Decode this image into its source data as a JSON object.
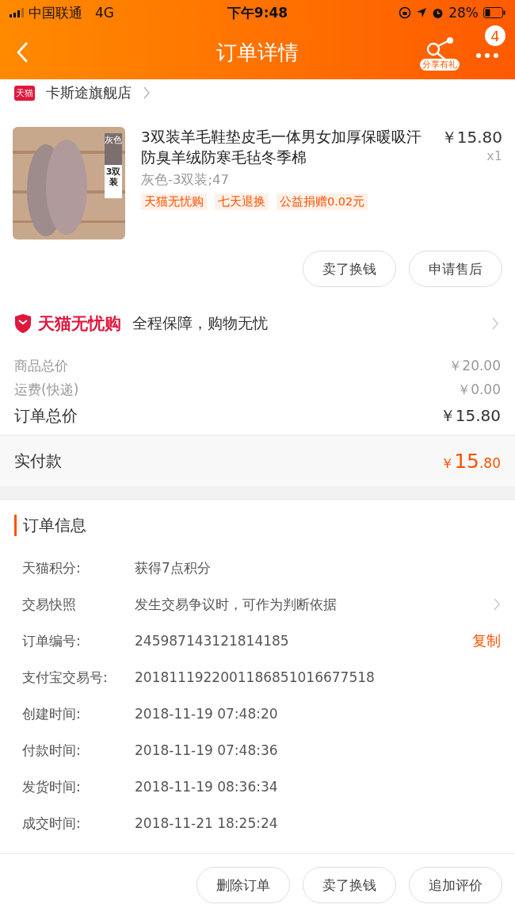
{
  "status_bar": {
    "carrier": "中国联通",
    "network": "4G",
    "time": "下午9:48",
    "battery": "28%"
  },
  "nav": {
    "title": "订单详情",
    "share_label": "分享有礼",
    "badge": "4"
  },
  "store": {
    "badge": "天猫",
    "name": "卡斯途旗舰店"
  },
  "product": {
    "image": {
      "kind": "picture",
      "tag_top": "灰色",
      "tag_bottom": "3双装"
    },
    "title": "3双装羊毛鞋垫皮毛一体男女加厚保暖吸汗防臭羊绒防寒毛毡冬季棉",
    "price": "￥15.80",
    "quantity": "x1",
    "sku": "灰色-3双装;47",
    "tags": [
      "天猫无忧购",
      "七天退换",
      "公益捐赠0.02元"
    ],
    "buttons": [
      "卖了换钱",
      "申请售后"
    ]
  },
  "guarantee": {
    "brand": "天猫无忧购",
    "text": "全程保障，购物无忧"
  },
  "costs": [
    {
      "kind": "minor",
      "label": "商品总价",
      "value": "￥20.00"
    },
    {
      "kind": "minor",
      "label": "运费(快递)",
      "value": "￥0.00"
    },
    {
      "kind": "major",
      "label": "订单总价",
      "value": "￥15.80"
    }
  ],
  "paid": {
    "label": "实付款",
    "currency": "￥",
    "integer": "15",
    "decimal": ".80"
  },
  "order_info": {
    "title": "订单信息",
    "rows": [
      {
        "label": "天猫积分:",
        "value": "获得7点积分"
      },
      {
        "label": "交易快照",
        "value": "发生交易争议时，可作为判断依据",
        "chevron": true
      },
      {
        "label": "订单编号:",
        "value": "245987143121814185",
        "action": "复制"
      },
      {
        "label": "支付宝交易号:",
        "value": "2018111922001186851016677518"
      },
      {
        "label": "创建时间:",
        "value": "2018-11-19 07:48:20"
      },
      {
        "label": "付款时间:",
        "value": "2018-11-19 07:48:36"
      },
      {
        "label": "发货时间:",
        "value": "2018-11-19 08:36:34"
      },
      {
        "label": "成交时间:",
        "value": "2018-11-21 18:25:24"
      }
    ]
  },
  "bottom_buttons": [
    "删除订单",
    "卖了换钱",
    "追加评价"
  ]
}
